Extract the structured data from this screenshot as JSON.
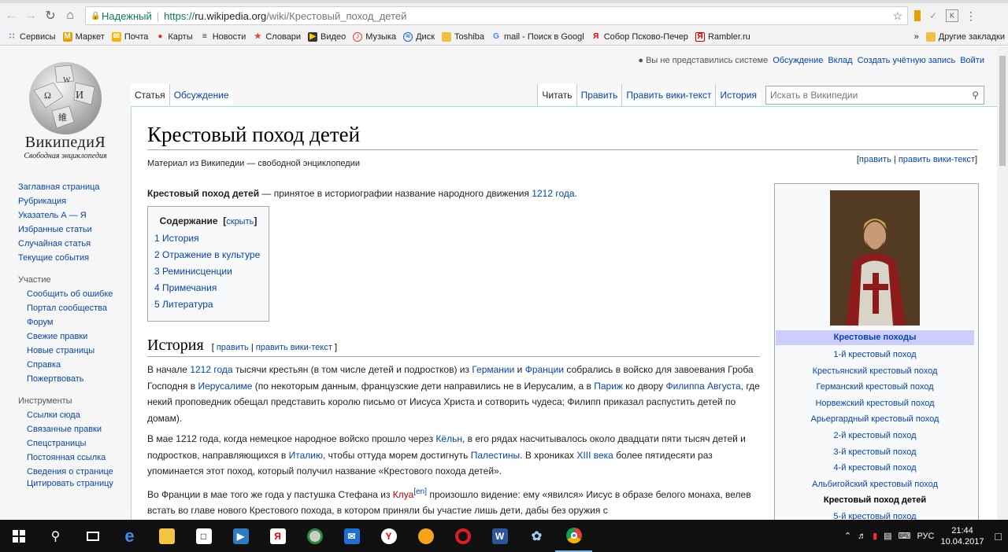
{
  "browser": {
    "secure_label": "Надежный",
    "url_proto": "https://",
    "url_host": "ru.wikipedia.org",
    "url_path": "/wiki/Крестовый_поход_детей",
    "bookmarks": [
      "Сервисы",
      "Маркет",
      "Почта",
      "Карты",
      "Новости",
      "Словари",
      "Видео",
      "Музыка",
      "Диск",
      "Toshiba",
      "mail - Поиск в Googl",
      "Собор Псково-Печер",
      "Rambler.ru"
    ],
    "more": "»",
    "other_bookmarks": "Другие закладки"
  },
  "personal": {
    "user": "Вы не представились системе",
    "talk": "Обсуждение",
    "contrib": "Вклад",
    "create": "Создать учётную запись",
    "login": "Войти"
  },
  "logo": {
    "wordmark": "ВикипедиЯ",
    "tagline": "Свободная энциклопедия"
  },
  "sidebar": {
    "main": [
      "Заглавная страница",
      "Рубрикация",
      "Указатель А — Я",
      "Избранные статьи",
      "Случайная статья",
      "Текущие события"
    ],
    "participation_title": "Участие",
    "participation": [
      "Сообщить об ошибке",
      "Портал сообщества",
      "Форум",
      "Свежие правки",
      "Новые страницы",
      "Справка",
      "Пожертвовать"
    ],
    "tools_title": "Инструменты",
    "tools": [
      "Ссылки сюда",
      "Связанные правки",
      "Спецстраницы",
      "Постоянная ссылка",
      "Сведения о странице",
      "Цитировать страницу"
    ]
  },
  "tabs": {
    "article": "Статья",
    "talk": "Обсуждение",
    "read": "Читать",
    "edit": "Править",
    "edit_source": "Править вики-текст",
    "history": "История",
    "search_placeholder": "Искать в Википедии"
  },
  "article": {
    "title": "Крестовый поход детей",
    "site_sub": "Материал из Википедии — свободной энциклопедии",
    "edit": "править",
    "edit_source": "править вики-текст",
    "lead_bold": "Крестовый поход детей",
    "lead_text": " — принятое в историографии название народного движения ",
    "lead_link": "1212 года",
    "lead_end": "."
  },
  "toc": {
    "title": "Содержание",
    "hide": "скрыть",
    "items": [
      {
        "num": "1",
        "label": "История"
      },
      {
        "num": "2",
        "label": "Отражение в культуре"
      },
      {
        "num": "3",
        "label": "Реминисценции"
      },
      {
        "num": "4",
        "label": "Примечания"
      },
      {
        "num": "5",
        "label": "Литература"
      }
    ]
  },
  "section": {
    "title": "История",
    "edit": "править",
    "edit_source": "править вики-текст"
  },
  "paragraphs": {
    "p1": {
      "t1": "В начале ",
      "l1": "1212 года",
      "t2": " тысячи крестьян (в том числе детей и подростков) из ",
      "l2": "Германии",
      "t3": " и ",
      "l3": "Франции",
      "t4": " собрались в войско для завоевания Гроба Господня в ",
      "l4": "Иерусалиме",
      "t5": " (по некоторым данным, французские дети направились не в Иерусалим, а в ",
      "l5": "Париж",
      "t6": " ко двору ",
      "l6": "Филиппа Августа",
      "t7": ", где некий проповедник обещал представить королю письмо от Иисуса Христа и сотворить чудеса; Филипп приказал распустить детей по домам)."
    },
    "p2": {
      "t1": "В мае 1212 года, когда немецкое народное войско прошло через ",
      "l1": "Кёльн",
      "t2": ", в его рядах насчитывалось около двадцати пяти тысяч детей и подростков, направляющихся в ",
      "l2": "Италию",
      "t3": ", чтобы оттуда морем достигнуть ",
      "l3": "Палестины",
      "t4": ". В хрониках ",
      "l4": "XIII века",
      "t5": " более пятидесяти раз упоминается этот поход, который получил название «Крестового похода детей»."
    },
    "p3": {
      "t1": "Во Франции в мае того же года у пастушка Стефана из ",
      "l1": "Клуа",
      "sup": "[en]",
      "t2": " произошло видение: ему «явился» Иисус в образе белого монаха, велев встать во главе нового Крестового похода, в котором приняли бы участие лишь дети, дабы без оружия с"
    }
  },
  "infobox": {
    "header": "Крестовые походы",
    "items": [
      "1-й крестовый поход",
      "Крестьянский крестовый поход",
      "Германский крестовый поход",
      "Норвежский крестовый поход",
      "Арьергардный крестовый поход",
      "2-й крестовый поход",
      "3-й крестовый поход",
      "4-й крестовый поход",
      "Альбигойский крестовый поход",
      "Крестовый поход детей",
      "5-й крестовый поход"
    ],
    "current_index": 9
  },
  "taskbar": {
    "lang": "РУС",
    "time": "21:44",
    "date": "10.04.2017"
  }
}
